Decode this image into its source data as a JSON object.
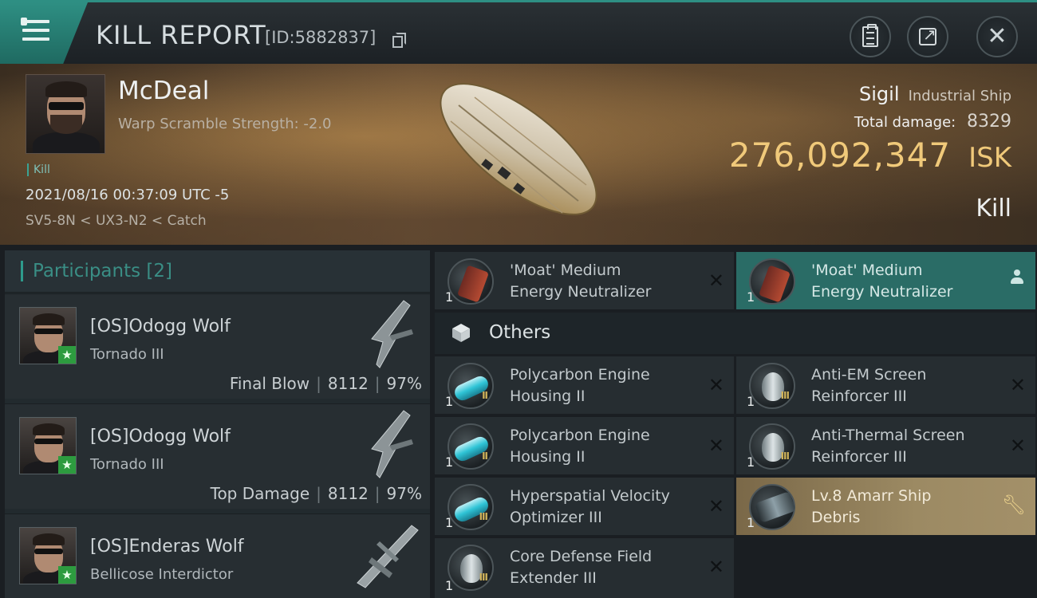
{
  "header": {
    "title": "KILL REPORT",
    "report_id": "[ID:5882837]"
  },
  "victim": {
    "pilot_name": "McDeal",
    "warp_scramble": "Warp Scramble Strength: -2.0",
    "kill_tag": "Kill",
    "timestamp": "2021/08/16 00:37:09 UTC -5",
    "route": "SV5-8N < UX3-N2 < Catch",
    "ship_name": "Sigil",
    "ship_class": "Industrial Ship",
    "total_damage_label": "Total damage:",
    "total_damage": "8329",
    "isk_value": "276,092,347",
    "isk_unit": "ISK",
    "result_label": "Kill"
  },
  "participants": {
    "header": "Participants [2]",
    "rows": [
      {
        "name": "[OS]Odogg Wolf",
        "ship": "Tornado III",
        "role": "Final Blow",
        "damage": "8112",
        "percent": "97%"
      },
      {
        "name": "[OS]Odogg Wolf",
        "ship": "Tornado III",
        "role": "Top Damage",
        "damage": "8112",
        "percent": "97%"
      },
      {
        "name": "[OS]Enderas Wolf",
        "ship": "Bellicose Interdictor"
      }
    ]
  },
  "fitting": {
    "mid_slots": [
      {
        "line1": "'Moat' Medium",
        "line2": "Energy Neutralizer",
        "qty": "1",
        "status": "destroyed"
      },
      {
        "line1": "'Moat' Medium",
        "line2": "Energy Neutralizer",
        "qty": "1",
        "status": "dropped"
      }
    ],
    "others_label": "Others",
    "others": [
      {
        "line1": "Polycarbon Engine",
        "line2": "Housing II",
        "qty": "1",
        "tier": "II"
      },
      {
        "line1": "Anti-EM Screen",
        "line2": "Reinforcer III",
        "qty": "1",
        "tier": "III"
      },
      {
        "line1": "Polycarbon Engine",
        "line2": "Housing II",
        "qty": "1",
        "tier": "II"
      },
      {
        "line1": "Anti-Thermal Screen",
        "line2": "Reinforcer III",
        "qty": "1",
        "tier": "III"
      },
      {
        "line1": "Hyperspatial Velocity",
        "line2": "Optimizer III",
        "qty": "1",
        "tier": "III"
      },
      {
        "line1": "Lv.8 Amarr Ship",
        "line2": "Debris",
        "qty": "1"
      },
      {
        "line1": "Core Defense Field",
        "line2": "Extender III",
        "qty": "1",
        "tier": "III"
      }
    ]
  },
  "colors": {
    "accent_teal": "#2e8f83",
    "isk_gold": "#f0c97a",
    "star_green": "#2d9b3f"
  }
}
